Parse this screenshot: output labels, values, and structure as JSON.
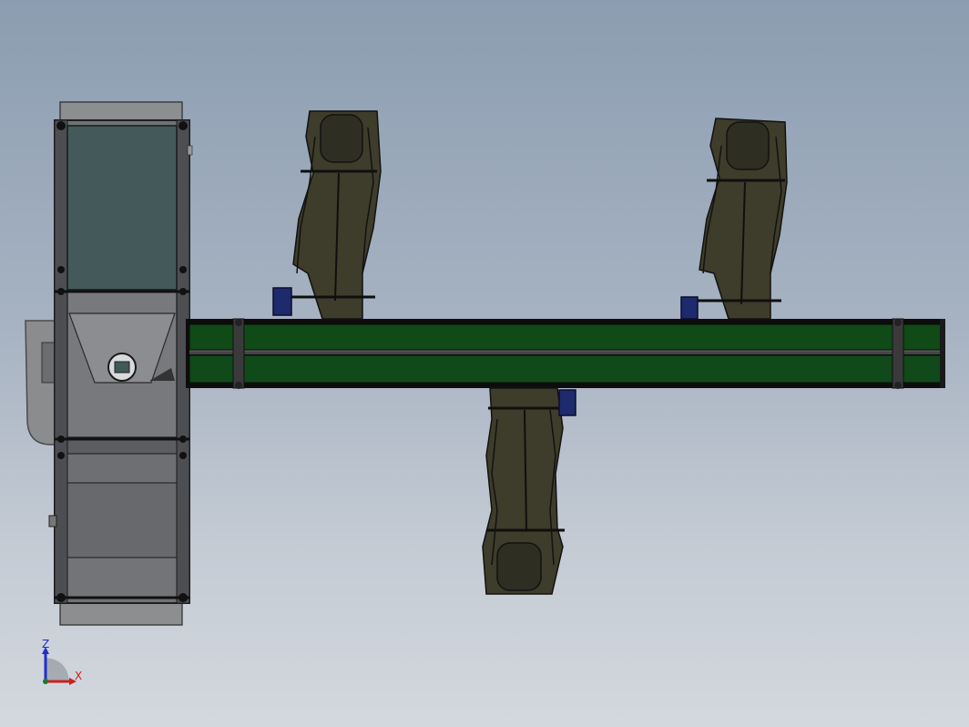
{
  "window": {
    "title": ""
  },
  "colors": {
    "background_top": "#8c9db1",
    "background_bottom": "#d3d8de",
    "conveyor_green": "#0f4a17",
    "machine_gray": "#6f7276",
    "window_teal": "#445a5a",
    "chute_dark": "#3e3c2a",
    "motor_blue": "#1e2a6e",
    "axis_x": "#cc1f1f",
    "axis_z": "#1f2fcc"
  },
  "view_triad": {
    "z_label": "Z",
    "x_label": "X"
  },
  "icons": [
    "view-orientation-triad-icon"
  ]
}
